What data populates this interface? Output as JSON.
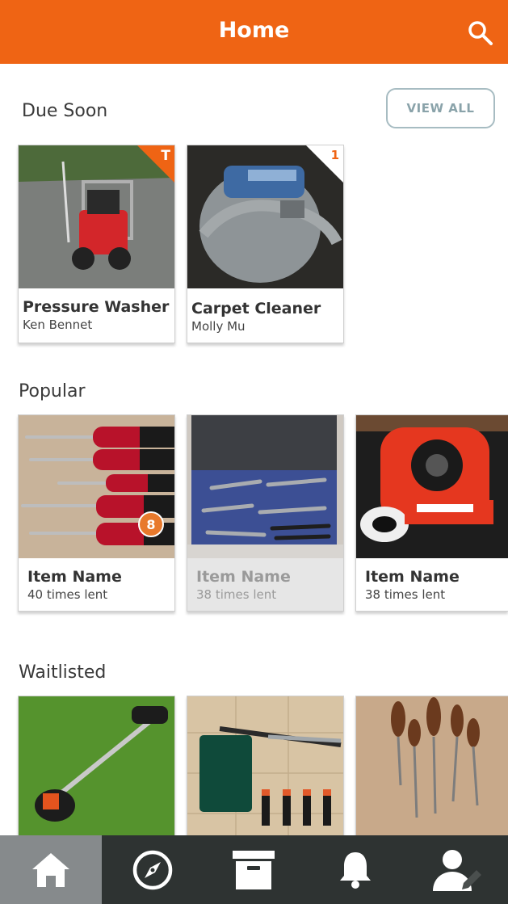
{
  "header": {
    "title": "Home"
  },
  "due_soon": {
    "title": "Due Soon",
    "view_all_label": "VIEW ALL",
    "items": [
      {
        "name": "Pressure Washer",
        "owner": "Ken Bennet",
        "corner_label": "T"
      },
      {
        "name": "Carpet Cleaner",
        "owner": "Molly Mu",
        "corner_label": "1"
      }
    ]
  },
  "popular": {
    "title": "Popular",
    "items": [
      {
        "name": "Item Name",
        "lent": "40 times lent",
        "badge": "8"
      },
      {
        "name": "Item Name",
        "lent": "38 times lent"
      },
      {
        "name": "Item Name",
        "lent": "38 times lent"
      }
    ]
  },
  "waitlisted": {
    "title": "Waitlisted"
  },
  "colors": {
    "accent": "#ef6414",
    "tabbar": "#2e3332",
    "tab_active": "#868a8c"
  }
}
